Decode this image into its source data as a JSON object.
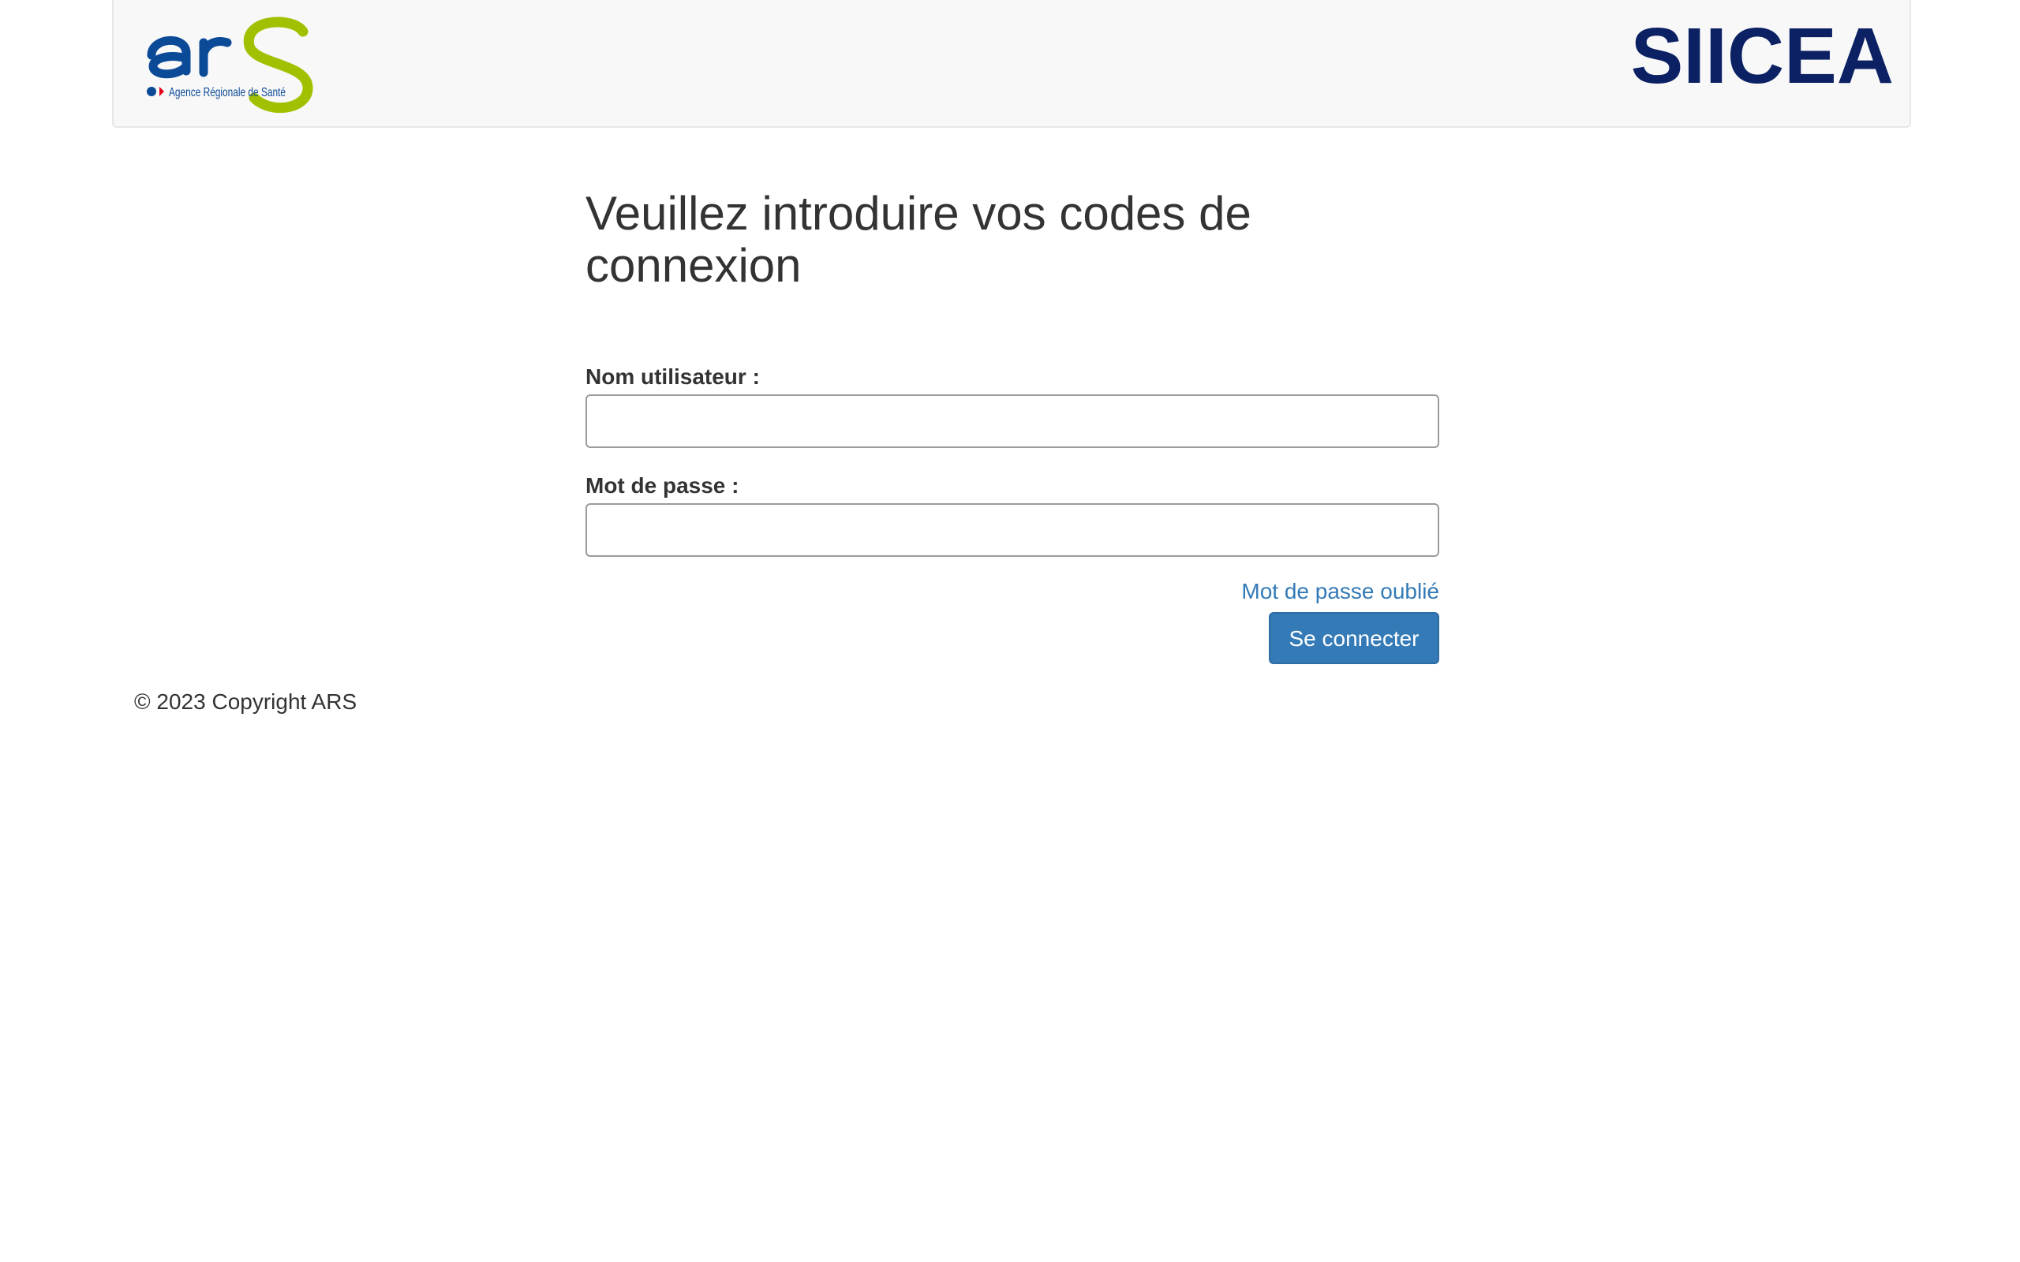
{
  "header": {
    "logo": {
      "mark_text": "ars",
      "tagline": "Agence Régionale de Santé",
      "colors": {
        "blue": "#0b4a97",
        "green": "#a1c100",
        "red": "#e2001a"
      }
    },
    "app_title": "SIICEA"
  },
  "main": {
    "title": "Veuillez introduire vos codes de connexion",
    "username": {
      "label": "Nom utilisateur :",
      "value": "",
      "placeholder": ""
    },
    "password": {
      "label": "Mot de passe :",
      "value": "",
      "placeholder": ""
    },
    "forgot_password": "Mot de passe oublié",
    "login_button": "Se connecter"
  },
  "footer": {
    "copyright": "© 2023 Copyright ARS"
  },
  "colors": {
    "primary": "#337ab7",
    "title_navy": "#0b2163",
    "header_bg": "#f8f8f8"
  }
}
